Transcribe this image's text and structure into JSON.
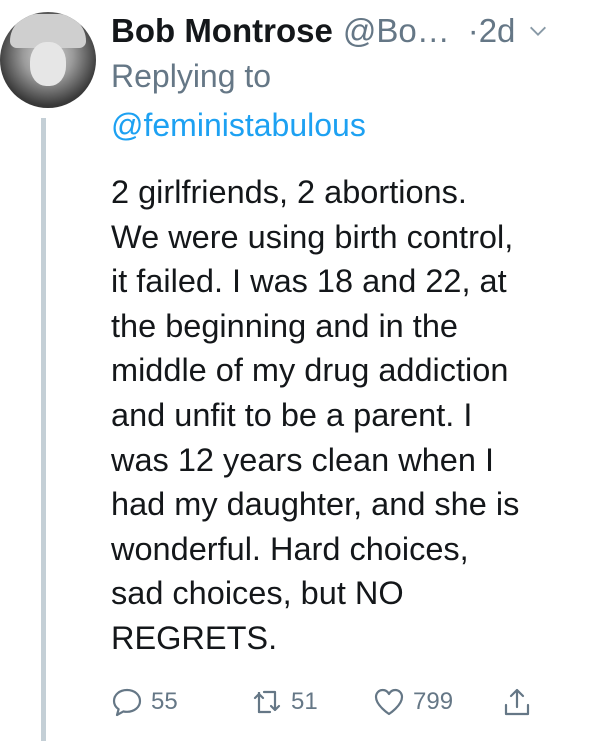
{
  "tweet": {
    "author_name": "Bob Montrose",
    "author_handle": "@Bo…",
    "time": "·2d",
    "replying_label": "Replying to",
    "replying_handle": "@feministabulous",
    "text_lines": [
      "2 girlfriends, 2 abortions.",
      "We were using birth control,",
      "it failed. I was 18 and 22, at",
      "the beginning and in the",
      "middle of my drug addiction",
      "and unfit to be a parent.  I",
      "was 12 years clean when I",
      "had my daughter, and she is",
      "wonderful. Hard choices,",
      "sad choices, but NO",
      "REGRETS."
    ]
  },
  "actions": {
    "reply_count": "55",
    "retweet_count": "51",
    "like_count": "799"
  },
  "icons": {
    "reply": "speech-bubble-icon",
    "retweet": "retweet-icon",
    "like": "heart-icon",
    "share": "share-icon",
    "menu": "chevron-down-icon"
  },
  "colors": {
    "link": "#1da1f2",
    "secondary_text": "#657786",
    "primary_text": "#14171a",
    "thread_line": "#c4cfd6"
  }
}
